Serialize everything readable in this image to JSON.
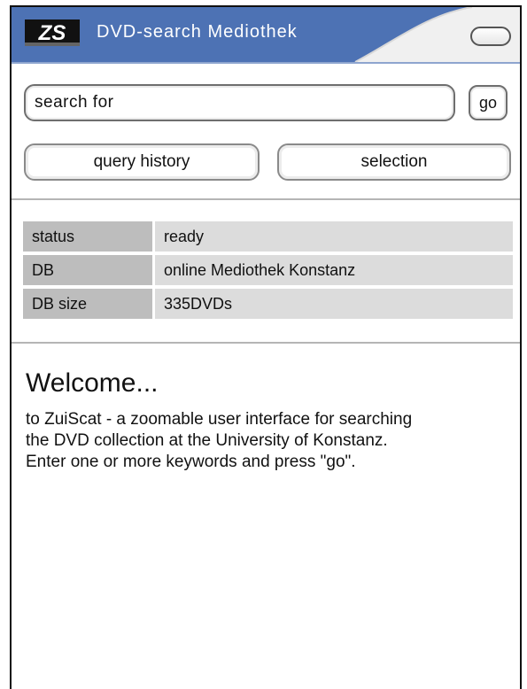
{
  "header": {
    "logo_text": "ZS",
    "title": "DVD-search Mediothek",
    "colors": {
      "bar": "#4d72b4",
      "swoosh": "#f0f0f0"
    }
  },
  "search": {
    "placeholder": "search for",
    "go_label": "go"
  },
  "actions": {
    "history_label": "query history",
    "selection_label": "selection"
  },
  "status": {
    "rows": [
      {
        "label": "status",
        "value": "ready"
      },
      {
        "label": "DB",
        "value": "online Mediothek Konstanz"
      },
      {
        "label": "DB size",
        "value": "335DVDs"
      }
    ]
  },
  "welcome": {
    "heading": "Welcome...",
    "lines": [
      "to ZuiScat - a zoomable user interface for searching",
      "the DVD collection at the University of Konstanz.",
      "Enter one or more keywords and press \"go\"."
    ]
  }
}
